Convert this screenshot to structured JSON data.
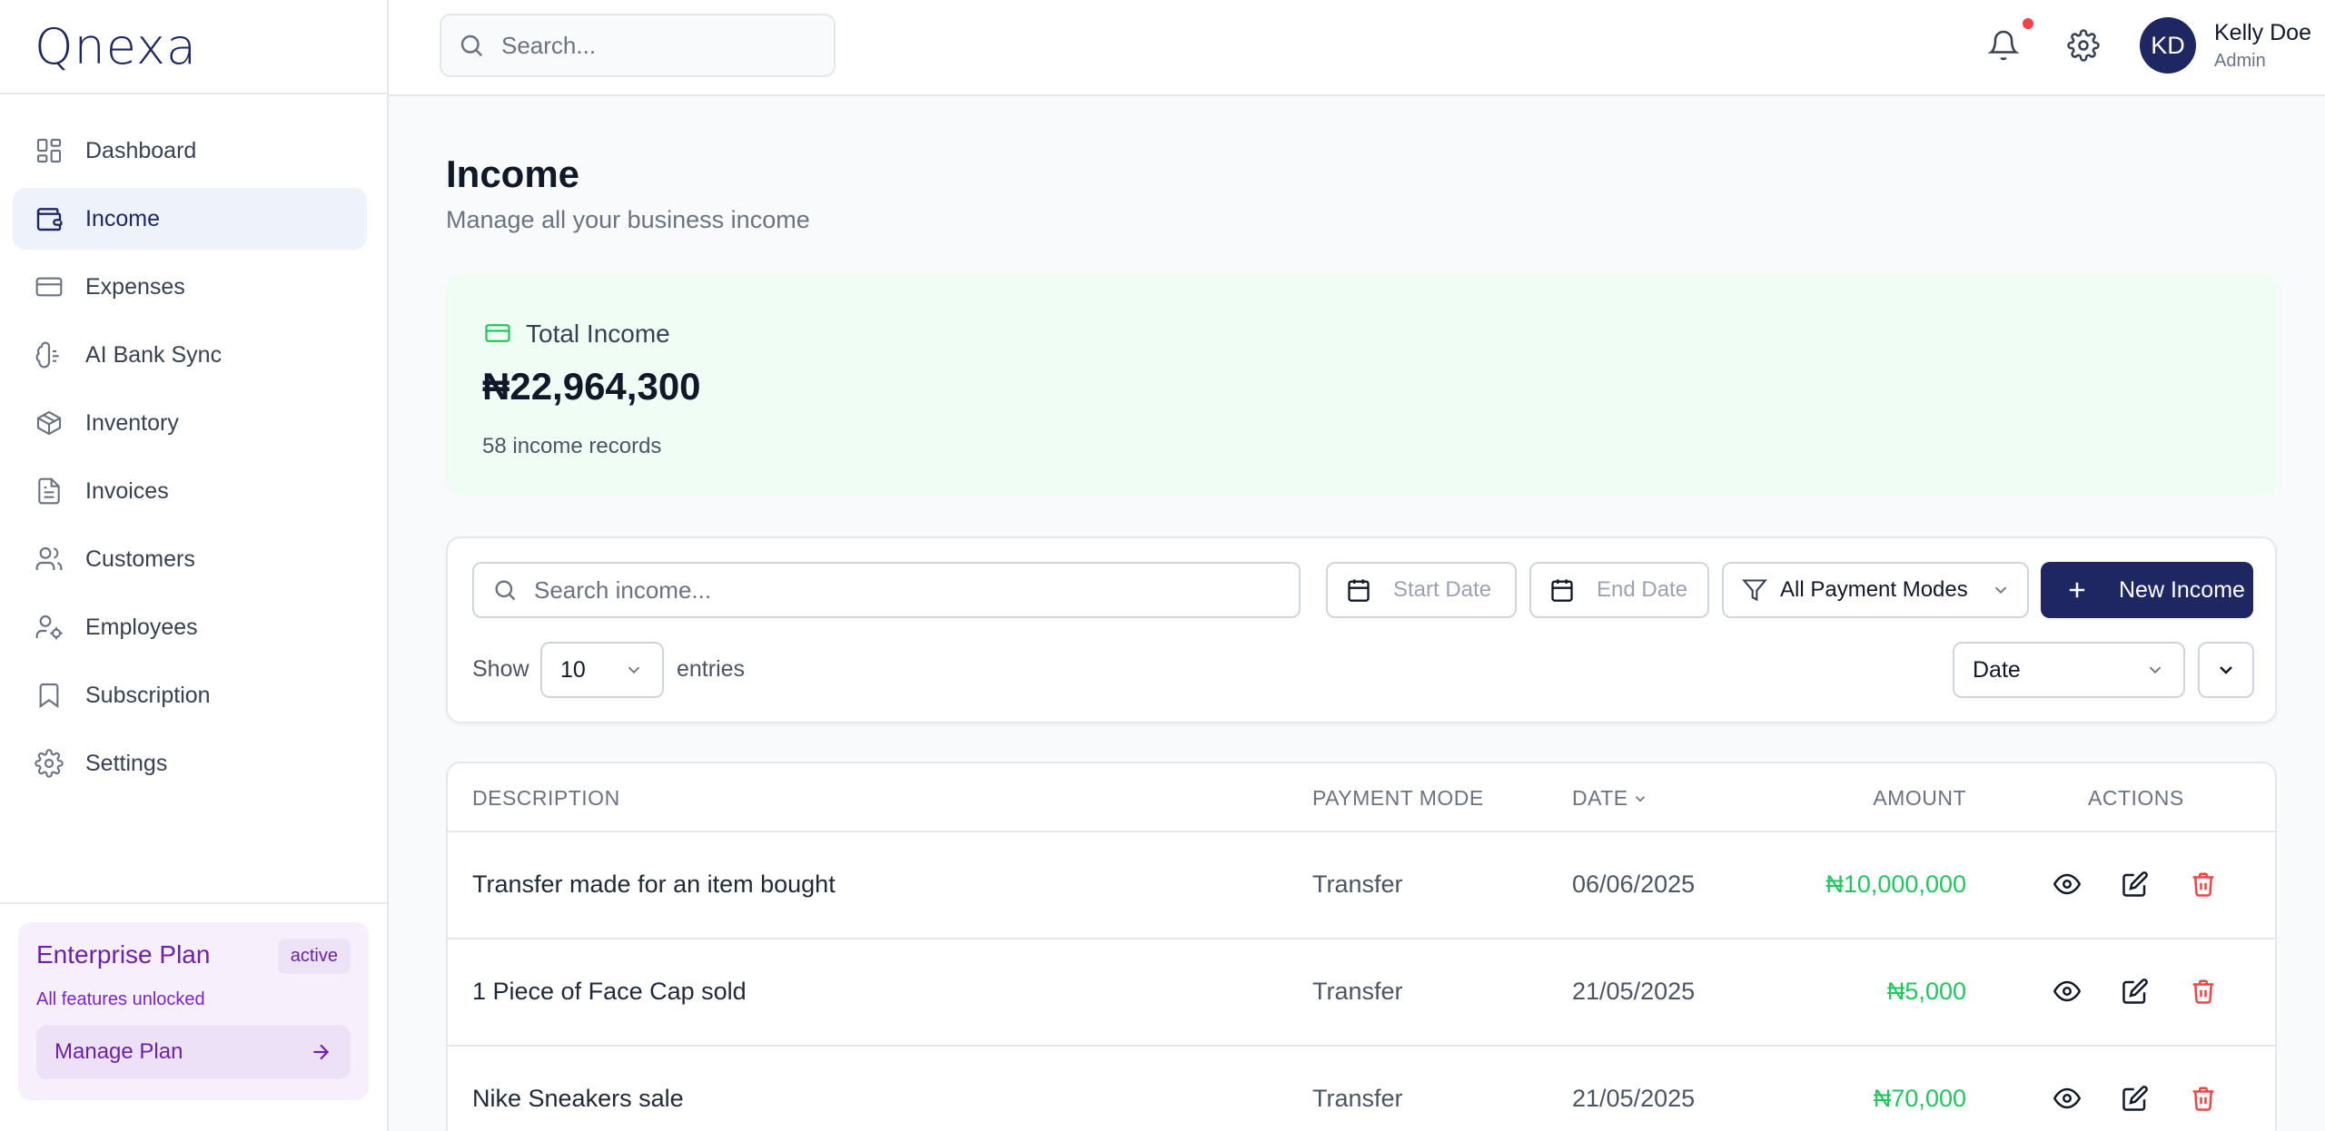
{
  "app": {
    "logo": "Qnexa"
  },
  "sidebar": {
    "items": [
      {
        "label": "Dashboard",
        "icon": "dashboard-icon",
        "active": false
      },
      {
        "label": "Income",
        "icon": "wallet-icon",
        "active": true
      },
      {
        "label": "Expenses",
        "icon": "credit-card-icon",
        "active": false
      },
      {
        "label": "AI Bank Sync",
        "icon": "brain-icon",
        "active": false
      },
      {
        "label": "Inventory",
        "icon": "package-icon",
        "active": false
      },
      {
        "label": "Invoices",
        "icon": "file-text-icon",
        "active": false
      },
      {
        "label": "Customers",
        "icon": "users-icon",
        "active": false
      },
      {
        "label": "Employees",
        "icon": "user-cog-icon",
        "active": false
      },
      {
        "label": "Subscription",
        "icon": "bookmark-icon",
        "active": false
      },
      {
        "label": "Settings",
        "icon": "gear-icon",
        "active": false
      }
    ],
    "plan": {
      "title": "Enterprise Plan",
      "badge": "active",
      "subtitle": "All features unlocked",
      "button": "Manage Plan"
    }
  },
  "header": {
    "search_placeholder": "Search...",
    "user": {
      "initials": "KD",
      "name": "Kelly Doe",
      "role": "Admin"
    }
  },
  "page": {
    "title": "Income",
    "subtitle": "Manage all your business income"
  },
  "summary": {
    "label": "Total Income",
    "value": "₦22,964,300",
    "count": "58 income records"
  },
  "filters": {
    "search_placeholder": "Search income...",
    "start_date": "Start Date",
    "end_date": "End Date",
    "payment_mode": "All Payment Modes",
    "new_button": "New Income",
    "show_label": "Show",
    "entries_value": "10",
    "entries_label": "entries",
    "sort_value": "Date"
  },
  "table": {
    "headers": {
      "description": "DESCRIPTION",
      "payment_mode": "PAYMENT MODE",
      "date": "DATE",
      "amount": "AMOUNT",
      "actions": "ACTIONS"
    },
    "rows": [
      {
        "description": "Transfer made for an item bought",
        "payment_mode": "Transfer",
        "date": "06/06/2025",
        "amount": "₦10,000,000"
      },
      {
        "description": "1 Piece of Face Cap sold",
        "payment_mode": "Transfer",
        "date": "21/05/2025",
        "amount": "₦5,000"
      },
      {
        "description": "Nike Sneakers sale",
        "payment_mode": "Transfer",
        "date": "21/05/2025",
        "amount": "₦70,000"
      }
    ]
  },
  "colors": {
    "brand": "#1e2761",
    "income_green": "#22c55e",
    "delete_red": "#ef4444",
    "plan_purple": "#6b21a8"
  }
}
